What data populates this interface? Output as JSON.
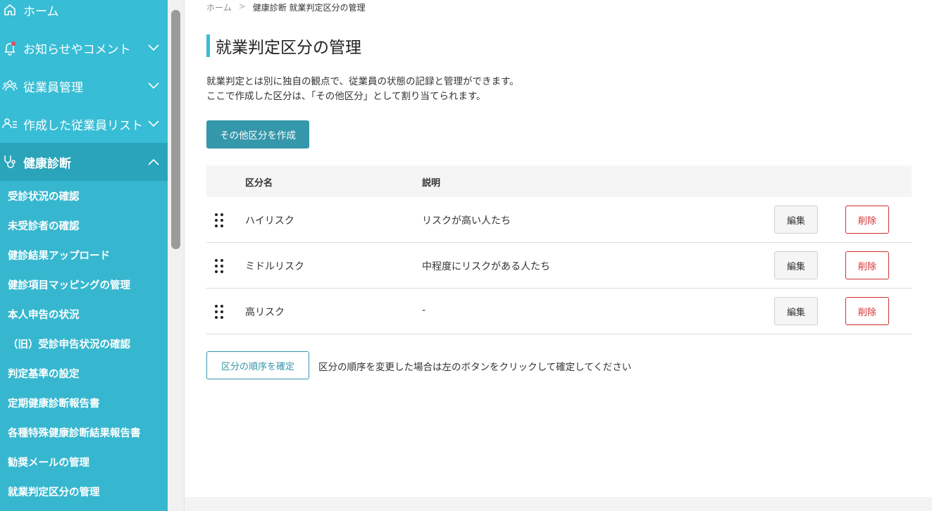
{
  "sidebar": {
    "nav": [
      {
        "label": "ホーム",
        "icon": "home-icon"
      },
      {
        "label": "お知らせやコメント",
        "icon": "bell-icon"
      },
      {
        "label": "従業員管理",
        "icon": "users-icon"
      },
      {
        "label": "作成した従業員リスト",
        "icon": "user-list-icon"
      },
      {
        "label": "健康診断",
        "icon": "stethoscope-icon"
      }
    ],
    "sub_items": [
      "受診状況の確認",
      "未受診者の確認",
      "健診結果アップロード",
      "健診項目マッピングの管理",
      "本人申告の状況",
      "（旧）受診申告状況の確認",
      "判定基準の設定",
      "定期健康診断報告書",
      "各種特殊健康診断結果報告書",
      "勧奨メールの管理",
      "就業判定区分の管理"
    ],
    "colors": {
      "bg": "#37bdd5",
      "active": "#2aa4ba",
      "notification_dot": "#e8465b"
    }
  },
  "breadcrumb": {
    "home": "ホーム",
    "separator": ">",
    "current": "健康診断 就業判定区分の管理"
  },
  "page": {
    "title": "就業判定区分の管理",
    "description_line1": "就業判定とは別に独自の観点で、従業員の状態の記録と管理ができます。",
    "description_line2": "ここで作成した区分は、「その他区分」として割り当てられます。",
    "create_button": "その他区分を作成"
  },
  "table": {
    "headers": {
      "name": "区分名",
      "description": "説明"
    },
    "rows": [
      {
        "name": "ハイリスク",
        "description": "リスクが高い人たち"
      },
      {
        "name": "ミドルリスク",
        "description": "中程度にリスクがある人たち"
      },
      {
        "name": "高リスク",
        "description": "-"
      }
    ],
    "edit_label": "編集",
    "delete_label": "削除"
  },
  "order": {
    "confirm_button": "区分の順序を確定",
    "note": "区分の順序を変更した場合は左のボタンをクリックして確定してください"
  }
}
